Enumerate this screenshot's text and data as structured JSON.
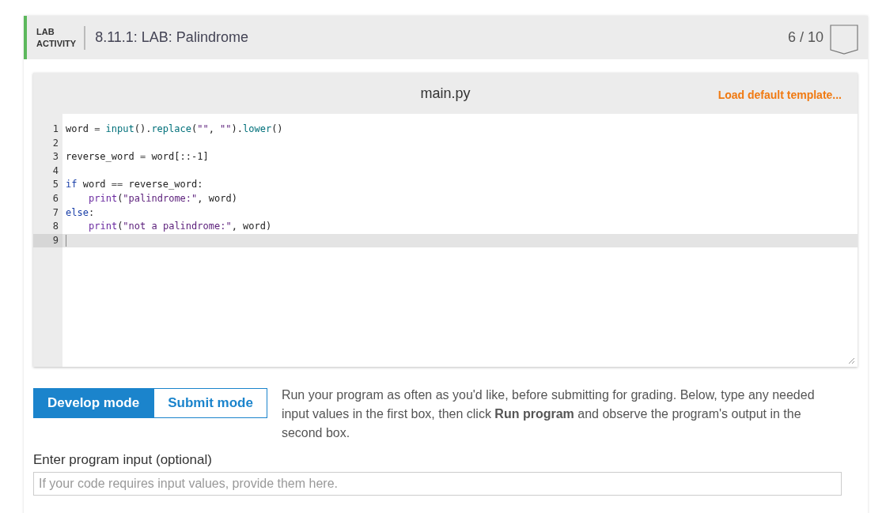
{
  "header": {
    "label_line1": "LAB",
    "label_line2": "ACTIVITY",
    "title": "8.11.1: LAB: Palindrome",
    "score": "6 / 10"
  },
  "editor": {
    "filename": "main.py",
    "template_link": "Load default template...",
    "lines": [
      {
        "number": "1",
        "active": false,
        "tokens": [
          {
            "kind": "name",
            "text": "word "
          },
          {
            "kind": "op",
            "text": "= "
          },
          {
            "kind": "call",
            "text": "input"
          },
          {
            "kind": "name",
            "text": "()."
          },
          {
            "kind": "call",
            "text": "replace"
          },
          {
            "kind": "name",
            "text": "("
          },
          {
            "kind": "string",
            "text": "\"\""
          },
          {
            "kind": "name",
            "text": ", "
          },
          {
            "kind": "string",
            "text": "\"\""
          },
          {
            "kind": "name",
            "text": ")."
          },
          {
            "kind": "call",
            "text": "lower"
          },
          {
            "kind": "name",
            "text": "()"
          }
        ]
      },
      {
        "number": "2",
        "active": false
      },
      {
        "number": "3",
        "active": false,
        "tokens": [
          {
            "kind": "name",
            "text": "reverse_word "
          },
          {
            "kind": "op",
            "text": "= "
          },
          {
            "kind": "name",
            "text": "word[::-1]"
          }
        ]
      },
      {
        "number": "4",
        "active": false
      },
      {
        "number": "5",
        "active": false,
        "tokens": [
          {
            "kind": "keyword",
            "text": "if"
          },
          {
            "kind": "name",
            "text": " word "
          },
          {
            "kind": "op",
            "text": "=="
          },
          {
            "kind": "name",
            "text": " reverse_word:"
          }
        ]
      },
      {
        "number": "6",
        "active": false,
        "indented": true,
        "tokens": [
          {
            "kind": "builtin",
            "text": "print"
          },
          {
            "kind": "name",
            "text": "("
          },
          {
            "kind": "string",
            "text": "\"palindrome:\""
          },
          {
            "kind": "name",
            "text": ", word)"
          }
        ]
      },
      {
        "number": "7",
        "active": false,
        "tokens": [
          {
            "kind": "keyword",
            "text": "else"
          },
          {
            "kind": "name",
            "text": ":"
          }
        ]
      },
      {
        "number": "8",
        "active": false,
        "indented": true,
        "tokens": [
          {
            "kind": "builtin",
            "text": "print"
          },
          {
            "kind": "name",
            "text": "("
          },
          {
            "kind": "string",
            "text": "\"not a palindrome:\""
          },
          {
            "kind": "name",
            "text": ", word)"
          }
        ]
      },
      {
        "number": "9",
        "active": true
      }
    ]
  },
  "modes": [
    {
      "label": "Develop mode",
      "selected": true
    },
    {
      "label": "Submit mode",
      "selected": false
    }
  ],
  "instructions": "Run your program as often as you'd like, before submitting for grading. Below, type any needed input values in the first box, then click **Run program** and observe the program's output in the second box.",
  "input": {
    "label": "Enter program input (optional)",
    "placeholder": "If your code requires input values, provide them here."
  }
}
